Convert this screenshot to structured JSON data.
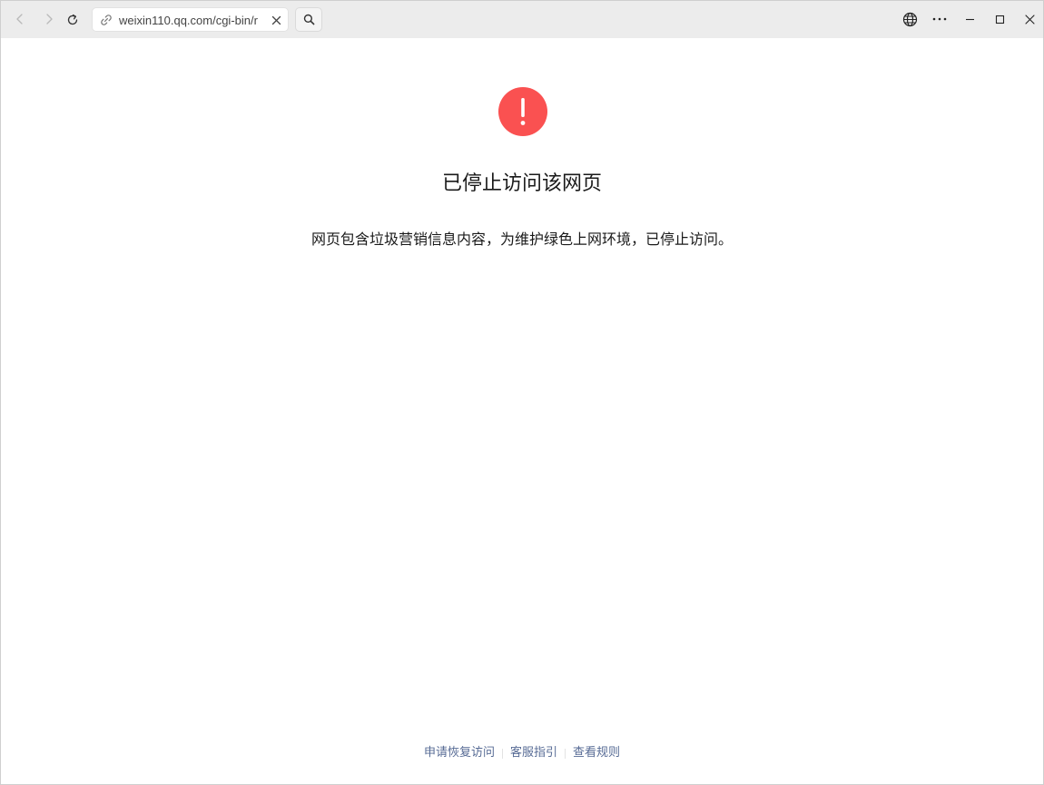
{
  "browser": {
    "address": {
      "url": "weixin110.qq.com/cgi-bin/r"
    },
    "icons": {
      "back": "chevron-left-icon",
      "forward": "chevron-right-icon",
      "reload": "reload-icon",
      "link": "link-icon",
      "clear": "close-icon",
      "search": "search-icon",
      "globe": "globe-icon",
      "more": "more-dots-icon",
      "minimize": "minimize-icon",
      "maximize": "maximize-icon",
      "close": "close-window-icon"
    }
  },
  "page": {
    "title": "已停止访问该网页",
    "description": "网页包含垃圾营销信息内容，为维护绿色上网环境，已停止访问。",
    "warning_icon": "exclamation-circle-icon",
    "warning_color": "#fa5151",
    "footer": {
      "links": [
        "申请恢复访问",
        "客服指引",
        "查看规则"
      ],
      "link_color": "#576b95"
    }
  }
}
